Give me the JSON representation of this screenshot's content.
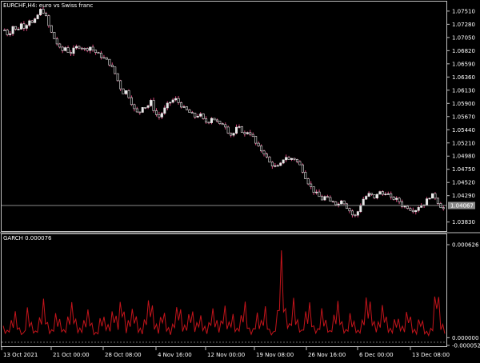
{
  "main_chart": {
    "title": "EURCHF,H4:  euro vs Swiss franc",
    "price_axis_labels": [
      "1.07510",
      "1.07280",
      "1.07050",
      "1.06820",
      "1.06590",
      "1.06360",
      "1.06130",
      "1.05900",
      "1.05670",
      "1.05440",
      "1.05210",
      "1.04980",
      "1.04750",
      "1.04520",
      "1.04290",
      "1.04067",
      "1.03830"
    ],
    "current_price": "1.04067",
    "colors": {
      "background": "#000000",
      "candle": "#e8e8e8",
      "wick": "#d64a7e",
      "current_line": "#8a8a8a",
      "price_box": "#8a8a8a"
    }
  },
  "indicator": {
    "title": "GARCH 0.000076",
    "axis_labels": [
      "0.000626",
      "0.000000",
      "-0.000052"
    ],
    "colors": {
      "line": "#c4141b",
      "zero_line": "#6e6e6e"
    }
  },
  "time_axis": {
    "labels": [
      "13 Oct 2021",
      "21 Oct 00:00",
      "28 Oct 08:00",
      "4 Nov 16:00",
      "12 Nov 00:00",
      "19 Nov 08:00",
      "26 Nov 16:00",
      "6 Dec 00:00",
      "13 Dec 08:00"
    ]
  },
  "chart_data": [
    {
      "type": "candlestick",
      "title": "EURCHF,H4:  euro vs Swiss franc",
      "ylim": [
        1.037,
        1.0762
      ],
      "y_ticks": [
        1.0751,
        1.0728,
        1.0705,
        1.0682,
        1.0659,
        1.0636,
        1.0613,
        1.059,
        1.0567,
        1.0544,
        1.0521,
        1.0498,
        1.0475,
        1.0452,
        1.0429,
        1.0383
      ],
      "current_price": 1.04067,
      "x_labels": [
        "13 Oct 2021",
        "21 Oct 00:00",
        "28 Oct 08:00",
        "4 Nov 16:00",
        "12 Nov 00:00",
        "19 Nov 08:00",
        "26 Nov 16:00",
        "6 Dec 00:00",
        "13 Dec 08:00"
      ],
      "close_path": [
        1.0718,
        1.0708,
        1.0725,
        1.0716,
        1.0729,
        1.0722,
        1.0737,
        1.0728,
        1.0742,
        1.0755,
        1.0745,
        1.0722,
        1.0706,
        1.0693,
        1.068,
        1.0688,
        1.0676,
        1.0684,
        1.069,
        1.0688,
        1.0683,
        1.0689,
        1.0681,
        1.0676,
        1.0671,
        1.0666,
        1.0658,
        1.0645,
        1.0627,
        1.0608,
        1.0612,
        1.0595,
        1.0578,
        1.0571,
        1.0586,
        1.0583,
        1.0593,
        1.0573,
        1.0566,
        1.0576,
        1.0587,
        1.0594,
        1.0598,
        1.059,
        1.0582,
        1.0577,
        1.0571,
        1.0566,
        1.0572,
        1.056,
        1.0556,
        1.0566,
        1.056,
        1.0552,
        1.0556,
        1.0541,
        1.0533,
        1.0546,
        1.0547,
        1.0535,
        1.0542,
        1.0533,
        1.0517,
        1.0509,
        1.0503,
        1.0488,
        1.0482,
        1.0478,
        1.0484,
        1.0499,
        1.0491,
        1.0496,
        1.0488,
        1.0479,
        1.0462,
        1.0448,
        1.0437,
        1.0431,
        1.0422,
        1.0428,
        1.0418,
        1.042,
        1.0412,
        1.0424,
        1.0411,
        1.0402,
        1.0391,
        1.0402,
        1.0421,
        1.0428,
        1.0433,
        1.0423,
        1.0437,
        1.0431,
        1.0436,
        1.0424,
        1.0424,
        1.042,
        1.041,
        1.041,
        1.0405,
        1.0403,
        1.0411,
        1.0413,
        1.0422,
        1.0431,
        1.0426,
        1.0413,
        1.0406
      ]
    },
    {
      "type": "line",
      "title": "GARCH 0.000076",
      "ylim": [
        -5.2e-05,
        0.000626
      ],
      "y_ticks": [
        0.000626,
        0.0,
        -5.2e-05
      ],
      "series": [
        {
          "values": [
            8e-05,
            5e-05,
            0.00012,
            0.00018,
            6e-05,
            3e-05,
            0.00022,
            9e-05,
            4e-05,
            0.00015,
            0.00028,
            7e-05,
            5e-05,
            0.00019,
            0.00011,
            4e-05,
            0.00017,
            0.00026,
            8e-05,
            6e-05,
            0.00014,
            0.00021,
            5e-05,
            3e-05,
            0.00018,
            0.00012,
            7e-05,
            0.00024,
            9e-05,
            0.00034,
            6e-05,
            0.00016,
            0.00022,
            8e-05,
            5e-05,
            0.00019,
            0.00031,
            0.00012,
            6e-05,
            0.00023,
            9e-05,
            4e-05,
            0.00016,
            0.00027,
            7e-05,
            0.00011,
            0.00024,
            6e-05,
            0.00018,
            9e-05,
            5e-05,
            0.00022,
            0.00014,
            6e-05,
            0.00026,
            8e-05,
            0.00019,
            5e-05,
            0.00012,
            0.00028,
            7e-05,
            4e-05,
            0.00018,
            0.0001,
            0.00023,
            6e-05,
            3e-05,
            0.00015,
            0.00061,
            0.0002,
            9e-05,
            0.00027,
            0.00012,
            5e-05,
            0.00018,
            0.00024,
            7e-05,
            6e-05,
            0.00021,
            0.00011,
            4e-05,
            0.00017,
            0.00026,
            8e-05,
            5e-05,
            0.00019,
            9e-05,
            4e-05,
            0.00014,
            0.00031,
            0.00022,
            7e-05,
            0.00012,
            0.00026,
            9e-05,
            5e-05,
            0.00016,
            0.00011,
            6e-05,
            0.00024,
            8e-05,
            4e-05,
            0.00018,
            6e-05,
            3e-05,
            9e-05,
            0.00044,
            0.00012,
            6e-05
          ]
        }
      ]
    }
  ]
}
